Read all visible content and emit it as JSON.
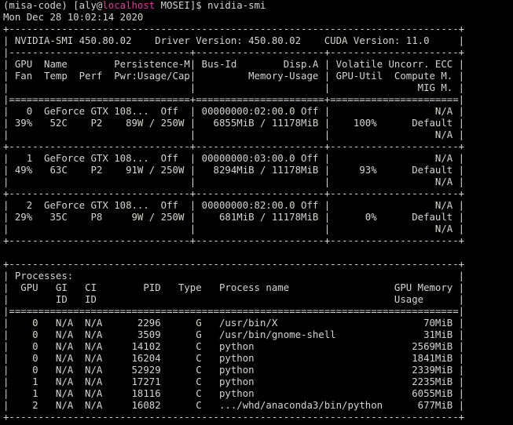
{
  "prompt": {
    "env": "(misa-code) [aly@",
    "host": "localhost",
    "path": " MOSEI]$ ",
    "command": "nvidia-smi"
  },
  "timestamp": "Mon Dec 28 10:02:14 2020",
  "colors": {
    "background": "#000000",
    "text": "#d3d7cf",
    "host": "#e5389e"
  },
  "lines": [
    "+-----------------------------------------------------------------------------+",
    "| NVIDIA-SMI 450.80.02    Driver Version: 450.80.02    CUDA Version: 11.0     |",
    "|-------------------------------+----------------------+----------------------+",
    "| GPU  Name        Persistence-M| Bus-Id        Disp.A | Volatile Uncorr. ECC |",
    "| Fan  Temp  Perf  Pwr:Usage/Cap|         Memory-Usage | GPU-Util  Compute M. |",
    "|                               |                      |               MIG M. |",
    "|===============================+======================+======================|",
    "|   0  GeForce GTX 108...  Off  | 00000000:02:00.0 Off |                  N/A |",
    "| 39%   52C    P2    89W / 250W |   6855MiB / 11178MiB |    100%      Default |",
    "|                               |                      |                  N/A |",
    "+-------------------------------+----------------------+----------------------+",
    "|   1  GeForce GTX 108...  Off  | 00000000:03:00.0 Off |                  N/A |",
    "| 49%   63C    P2    91W / 250W |   8294MiB / 11178MiB |     93%      Default |",
    "|                               |                      |                  N/A |",
    "+-------------------------------+----------------------+----------------------+",
    "|   2  GeForce GTX 108...  Off  | 00000000:82:00.0 Off |                  N/A |",
    "| 29%   35C    P8     9W / 250W |    681MiB / 11178MiB |      0%      Default |",
    "|                               |                      |                  N/A |",
    "+-------------------------------+----------------------+----------------------+",
    "                                                                               ",
    "+-----------------------------------------------------------------------------+",
    "| Processes:                                                                  |",
    "|  GPU   GI   CI        PID   Type   Process name                  GPU Memory |",
    "|        ID   ID                                                   Usage      |",
    "|=============================================================================|",
    "|    0   N/A  N/A      2296      G   /usr/bin/X                         70MiB |",
    "|    0   N/A  N/A      3509      G   /usr/bin/gnome-shell               31MiB |",
    "|    0   N/A  N/A     14102      C   python                           2569MiB |",
    "|    0   N/A  N/A     16204      C   python                           1841MiB |",
    "|    0   N/A  N/A     52929      C   python                           2339MiB |",
    "|    1   N/A  N/A     17271      C   python                           2235MiB |",
    "|    1   N/A  N/A     18116      C   python                           6055MiB |",
    "|    2   N/A  N/A     16082      C   .../whd/anaconda3/bin/python      677MiB |",
    "+-----------------------------------------------------------------------------+"
  ]
}
